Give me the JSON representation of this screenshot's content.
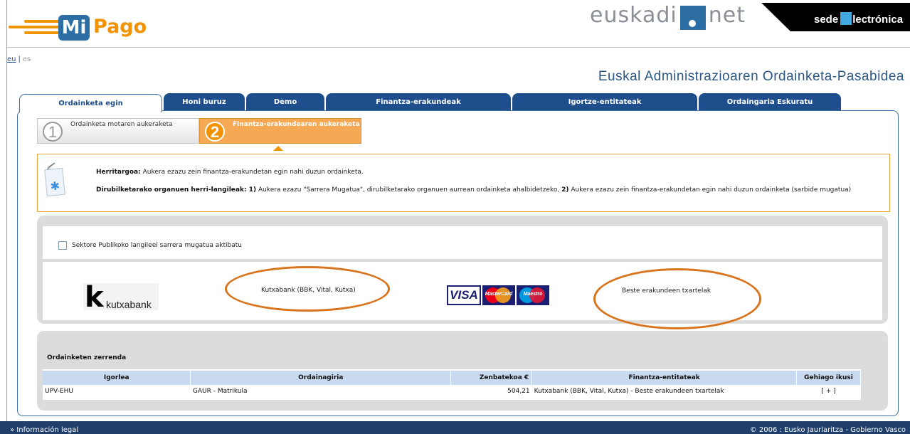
{
  "header": {
    "logo_mi": "Mi",
    "logo_pago": "Pago",
    "euskadi_left": "euskadi",
    "euskadi_right": "net",
    "sede_left": "sede",
    "sede_right": "lectrónica"
  },
  "lang": {
    "eu": "eu",
    "es": "es"
  },
  "page_title": "Euskal Administrazioaren Ordainketa-Pasabidea",
  "tabs": [
    "Ordainketa egin",
    "Honi buruz",
    "Demo",
    "Finantza-erakundeak",
    "Igortze-entitateak",
    "Ordaingaria Eskuratu"
  ],
  "steps": [
    {
      "number": "1",
      "label": "Ordainketa motaren aukeraketa"
    },
    {
      "number": "2",
      "label": "Finantza-erakundearen aukeraketa"
    }
  ],
  "info": {
    "line1_bold": "Herritargoa:",
    "line1_text": " Aukera ezazu zein finantza-erakundetan egin nahi duzun ordainketa.",
    "line2_bold": "Dirubilketarako organuen herri-langileak:",
    "line2_b1": " 1)",
    "line2_t1": " Aukera ezazu \"Sarrera Mugatua\", dirubilketarako organuen aurrean ordainketa ahalbidetzeko, ",
    "line2_b2": "2)",
    "line2_t2": " Aukera ezazu zein finantza-erakundetan egin nahi duzun ordainketa (sarbide mugatua)"
  },
  "options": {
    "checkbox_label": "Sektore Publikoko langileei sarrera mugatua aktibatu",
    "kutxa_logo": "kutxabank",
    "kutxa_label": "Kutxabank (BBK, Vital, Kutxa)",
    "cards_label": "Beste erakundeen txartelak",
    "visa": "VISA",
    "mastercard": "MasterCard",
    "maestro": "Maestro"
  },
  "payments": {
    "title": "Ordainketen zerrenda",
    "columns": [
      "Igorlea",
      "Ordainagiria",
      "Zenbatekoa €",
      "Finantza-entitateak",
      "Gehiago ikusi"
    ],
    "rows": [
      {
        "igorlea": "UPV-EHU",
        "ordainagiria": "GAUR - Matrikula",
        "zenbatekoa": "504,21",
        "entitateak": "Kutxabank (BBK, Vital, Kutxa) - Beste erakundeen txartelak",
        "more": "[ + ]"
      }
    ]
  },
  "footer": {
    "left": "» Información legal",
    "right": "© 2006 : Eusko Jaurlaritza - Gobierno Vasco"
  },
  "colors": {
    "brand_orange": "#f39200",
    "brand_blue": "#1f4e8c",
    "annotation_ellipse": "#d9741c"
  }
}
